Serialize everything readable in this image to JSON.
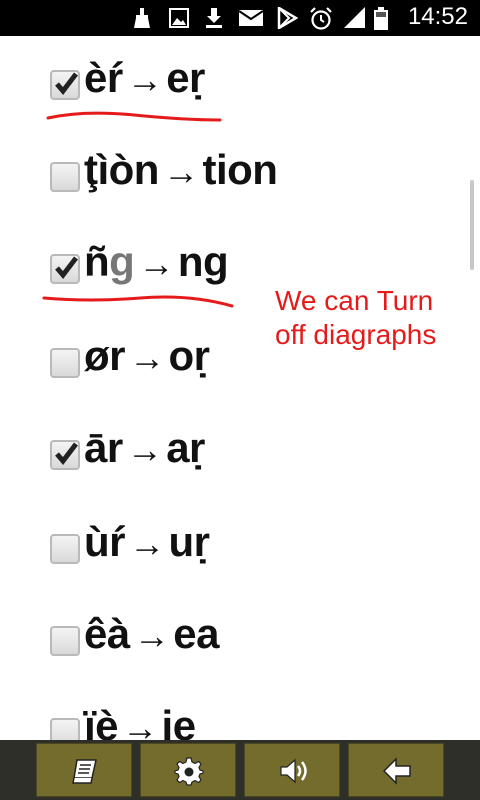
{
  "status_bar": {
    "time": "14:52",
    "icons": [
      "cleaner-icon",
      "image-icon",
      "download-icon",
      "mail-icon",
      "play-store-icon",
      "alarm-icon",
      "signal-icon",
      "battery-icon"
    ]
  },
  "rules": [
    {
      "from": "èŕ",
      "to": "eṛ",
      "checked": true,
      "underlined": true
    },
    {
      "from": "ţìòn",
      "to": "tion",
      "checked": false
    },
    {
      "from_main": "ñ",
      "from_dim": "g",
      "to": "ng",
      "checked": true,
      "underlined": true
    },
    {
      "from": "ør",
      "to": "oṛ",
      "checked": false
    },
    {
      "from": "ār",
      "to": "aṛ",
      "checked": true
    },
    {
      "from": "ùŕ",
      "to": "uṛ",
      "checked": false
    },
    {
      "from": "êà",
      "to": "ea",
      "checked": false
    },
    {
      "from": "ïè",
      "to": "ie",
      "checked": false
    }
  ],
  "arrow": "→",
  "annotation": {
    "line1": "We can Turn",
    "line2": "off diagraphs",
    "color": "#e51b1b"
  },
  "toolbar": {
    "buttons": [
      {
        "name": "book-icon"
      },
      {
        "name": "gear-icon"
      },
      {
        "name": "speaker-icon"
      },
      {
        "name": "back-arrow-icon"
      }
    ],
    "button_color": "#736c2c"
  }
}
